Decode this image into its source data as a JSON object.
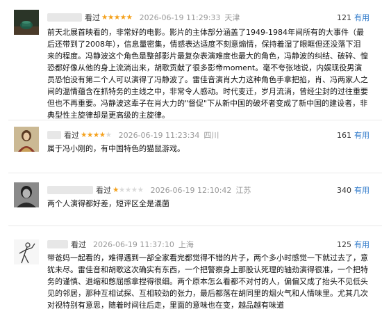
{
  "reviews": [
    {
      "action": "看过",
      "stars": 5,
      "time": "2026-06-19 11:29:33",
      "location": "天津",
      "votes": "121",
      "useful_label": "有用",
      "text": "前天北展首映看的，非常好的电影。影片的主体部分涵盖了1949-1984年间所有的大事件（最后还带到了2008年），信息量密集，情感表达适度不刻意煽情，保持着湿了眼眶但还没落下泪来的程度。冯静波这个角色是整部影片最复杂表演难度也最大的角色，冯静波的纠结、破碎、惶恐都好像从他的身上流淌出来，胡歌贡献了很多影帝moment。毫不夸张地说，内娱现役男演员恐怕没有第二个人可以演得了冯静波了。雷佳音演肖大力这种角色手拿把掐，肖、冯两家人之间的温情蕴含在抓特务的主线之中，非常令人感动。时代变迁，岁月流淌，曾经尘封的过往重要但也不再重要。冯静波这辈子在肖大力的\"督促\"下从新中国的破坏者变成了新中国的建设者，非典型性主旋律却是更高级的主旋律。"
    },
    {
      "action": "看过",
      "stars": 4,
      "time": "2026-06-19 11:23:34",
      "location": "四川",
      "votes": "161",
      "useful_label": "有用",
      "text": "属于冯小刚的，有中国特色的猫鼠游戏。"
    },
    {
      "action": "看过",
      "stars": 1,
      "time": "2026-06-19 12:10:42",
      "location": "江苏",
      "votes": "340",
      "useful_label": "有用",
      "text": "两个人演得都好差，短评区全是𣿭菌"
    },
    {
      "action": "看过",
      "stars": 0,
      "time": "2026-06-19 11:37:10",
      "location": "上海",
      "votes": "125",
      "useful_label": "有用",
      "text": "带爸妈一起看的，难得遇到一部全家看完都觉得不错的片子，两个多小时感觉一下就过去了，意犹未尽。雷佳音和胡歌这次确实有东西，一个把警察身上那股认死理的轴劲演得很准，一个把特务的谨慎、退缩和憋屈感拿捏得很细。两个原本怎么看都不对付的人，偏偏又成了抬头不见低头见的邻居，那种互相试探、互相较劲的张力，最后都落在胡同里的烟火气和人情味里。尤其几次对视特别有意思，随着时间往后走，里面的意味也在变，越品越有味道"
    }
  ]
}
